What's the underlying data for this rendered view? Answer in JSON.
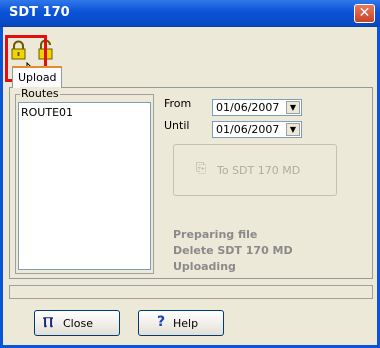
{
  "window": {
    "title": "SDT 170",
    "close_glyph": "✕"
  },
  "toolbar": {
    "lock_closed_icon": "lock-closed-icon",
    "lock_open_icon": "lock-open-icon"
  },
  "tabs": [
    {
      "label": "Upload",
      "selected": true
    }
  ],
  "routes": {
    "group_label": "Routes",
    "items": [
      "ROUTE01"
    ]
  },
  "dates": {
    "from_label": "From",
    "from_value": "01/06/2007",
    "until_label": "Until",
    "until_value": "01/06/2007"
  },
  "send_button": {
    "label": "To SDT 170 MD",
    "enabled": false
  },
  "status_lines": [
    "Preparing file",
    "Delete SDT 170 MD",
    "Uploading"
  ],
  "buttons": {
    "close_label": "Close",
    "help_label": "Help"
  },
  "colors": {
    "title_bar": "#0a54d8",
    "highlight_box": "#e01010",
    "disabled_text": "#8a8a8a"
  }
}
